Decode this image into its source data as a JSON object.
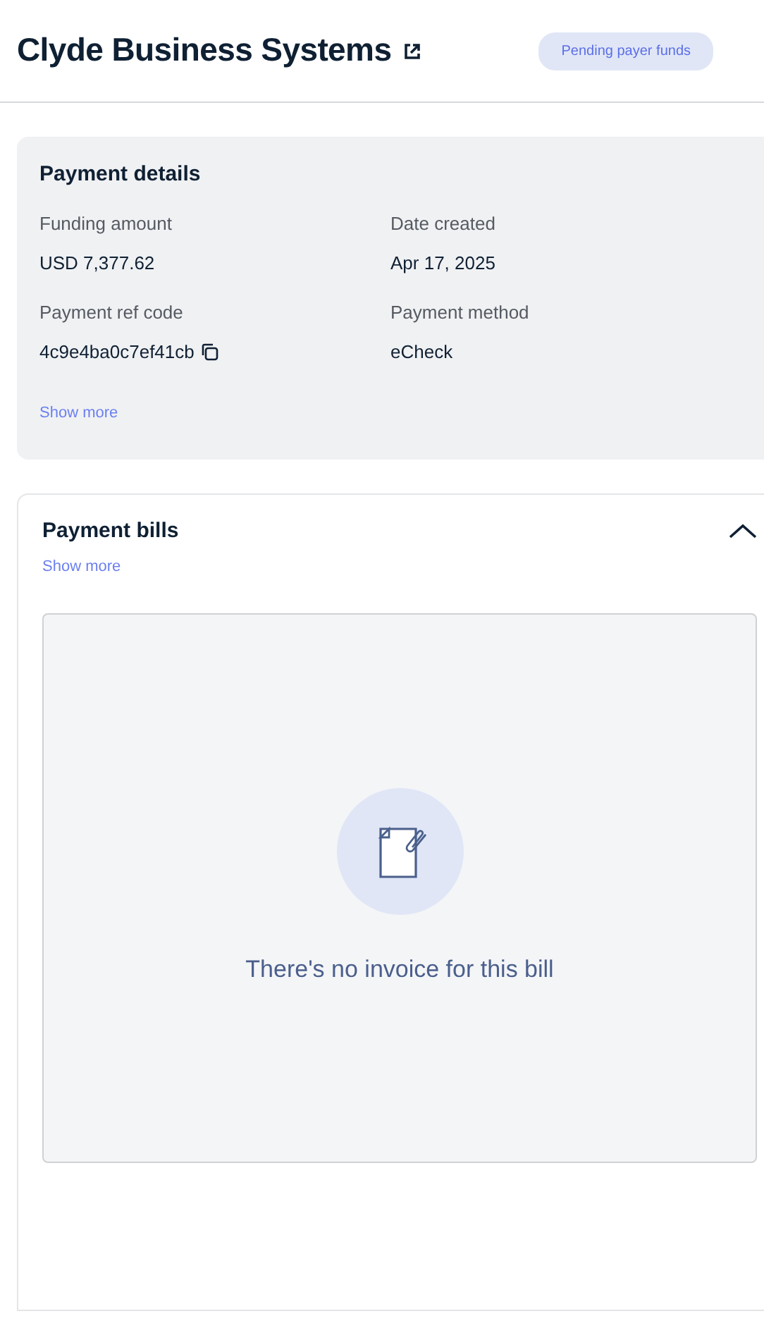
{
  "header": {
    "title": "Clyde Business Systems",
    "status_badge": "Pending payer funds"
  },
  "payment_details": {
    "title": "Payment details",
    "fields": [
      {
        "label": "Funding amount",
        "value": "USD 7,377.62",
        "copyable": false
      },
      {
        "label": "Date created",
        "value": "Apr 17, 2025",
        "copyable": false
      },
      {
        "label": "Payment ref code",
        "value": "4c9e4ba0c7ef41cb",
        "copyable": true
      },
      {
        "label": "Payment method",
        "value": "eCheck",
        "copyable": false
      }
    ],
    "show_more": "Show more"
  },
  "payment_bills": {
    "title": "Payment bills",
    "expanded": true,
    "show_more": "Show more",
    "empty_message": "There's no invoice for this bill"
  }
}
